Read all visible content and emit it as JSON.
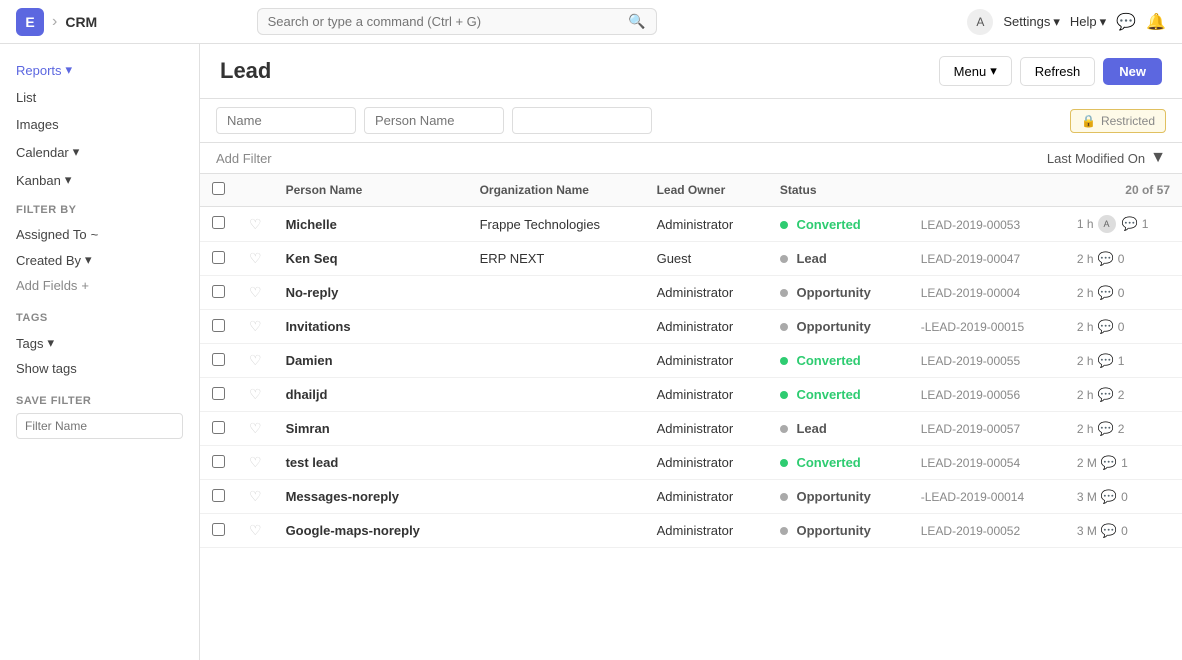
{
  "app": {
    "icon": "E",
    "module": "CRM"
  },
  "search": {
    "placeholder": "Search or type a command (Ctrl + G)"
  },
  "nav_right": {
    "avatar": "A",
    "settings_label": "Settings",
    "help_label": "Help"
  },
  "sidebar": {
    "reports_label": "Reports",
    "list_label": "List",
    "images_label": "Images",
    "calendar_label": "Calendar",
    "kanban_label": "Kanban",
    "filter_by_label": "Filter By",
    "assigned_to_label": "Assigned To",
    "created_by_label": "Created By",
    "add_fields_label": "Add Fields",
    "tags_label": "Tags",
    "show_tags_label": "Show tags",
    "save_filter_label": "Save Filter",
    "filter_name_placeholder": "Filter Name"
  },
  "page": {
    "title": "Lead",
    "menu_label": "Menu",
    "refresh_label": "Refresh",
    "new_label": "New"
  },
  "filters": {
    "name_placeholder": "Name",
    "person_name_placeholder": "Person Name",
    "extra_placeholder": "",
    "restricted_label": "Restricted",
    "add_filter_label": "Add Filter",
    "last_modified_label": "Last Modified On"
  },
  "table": {
    "headers": [
      "",
      "",
      "Person Name",
      "Organization Name",
      "Lead Owner",
      "Status",
      "",
      ""
    ],
    "row_count": "20 of 57",
    "rows": [
      {
        "name": "Michelle",
        "org": "Frappe Technologies",
        "owner": "Administrator",
        "status": "Converted",
        "status_type": "converted",
        "lead_id": "LEAD-2019-00053",
        "time": "1 h",
        "has_avatar": true,
        "comments": 1
      },
      {
        "name": "Ken Seq",
        "org": "ERP NEXT",
        "owner": "Guest",
        "status": "Lead",
        "status_type": "lead",
        "lead_id": "LEAD-2019-00047",
        "time": "2 h",
        "has_avatar": false,
        "comments": 0
      },
      {
        "name": "No-reply",
        "org": "",
        "owner": "Administrator",
        "status": "Opportunity",
        "status_type": "opportunity",
        "lead_id": "LEAD-2019-00004",
        "time": "2 h",
        "has_avatar": false,
        "comments": 0
      },
      {
        "name": "Invitations",
        "org": "",
        "owner": "Administrator",
        "status": "Opportunity",
        "status_type": "opportunity",
        "lead_id": "-LEAD-2019-00015",
        "time": "2 h",
        "has_avatar": false,
        "comments": 0
      },
      {
        "name": "Damien",
        "org": "",
        "owner": "Administrator",
        "status": "Converted",
        "status_type": "converted",
        "lead_id": "LEAD-2019-00055",
        "time": "2 h",
        "has_avatar": false,
        "comments": 1
      },
      {
        "name": "dhailjd",
        "org": "",
        "owner": "Administrator",
        "status": "Converted",
        "status_type": "converted",
        "lead_id": "LEAD-2019-00056",
        "time": "2 h",
        "has_avatar": false,
        "comments": 2
      },
      {
        "name": "Simran",
        "org": "",
        "owner": "Administrator",
        "status": "Lead",
        "status_type": "lead",
        "lead_id": "LEAD-2019-00057",
        "time": "2 h",
        "has_avatar": false,
        "comments": 2
      },
      {
        "name": "test lead",
        "org": "",
        "owner": "Administrator",
        "status": "Converted",
        "status_type": "converted",
        "lead_id": "LEAD-2019-00054",
        "time": "2 M",
        "has_avatar": false,
        "comments": 1
      },
      {
        "name": "Messages-noreply",
        "org": "",
        "owner": "Administrator",
        "status": "Opportunity",
        "status_type": "opportunity",
        "lead_id": "-LEAD-2019-00014",
        "time": "3 M",
        "has_avatar": false,
        "comments": 0
      },
      {
        "name": "Google-maps-noreply",
        "org": "",
        "owner": "Administrator",
        "status": "Opportunity",
        "status_type": "opportunity",
        "lead_id": "LEAD-2019-00052",
        "time": "3 M",
        "has_avatar": false,
        "comments": 0
      }
    ]
  }
}
